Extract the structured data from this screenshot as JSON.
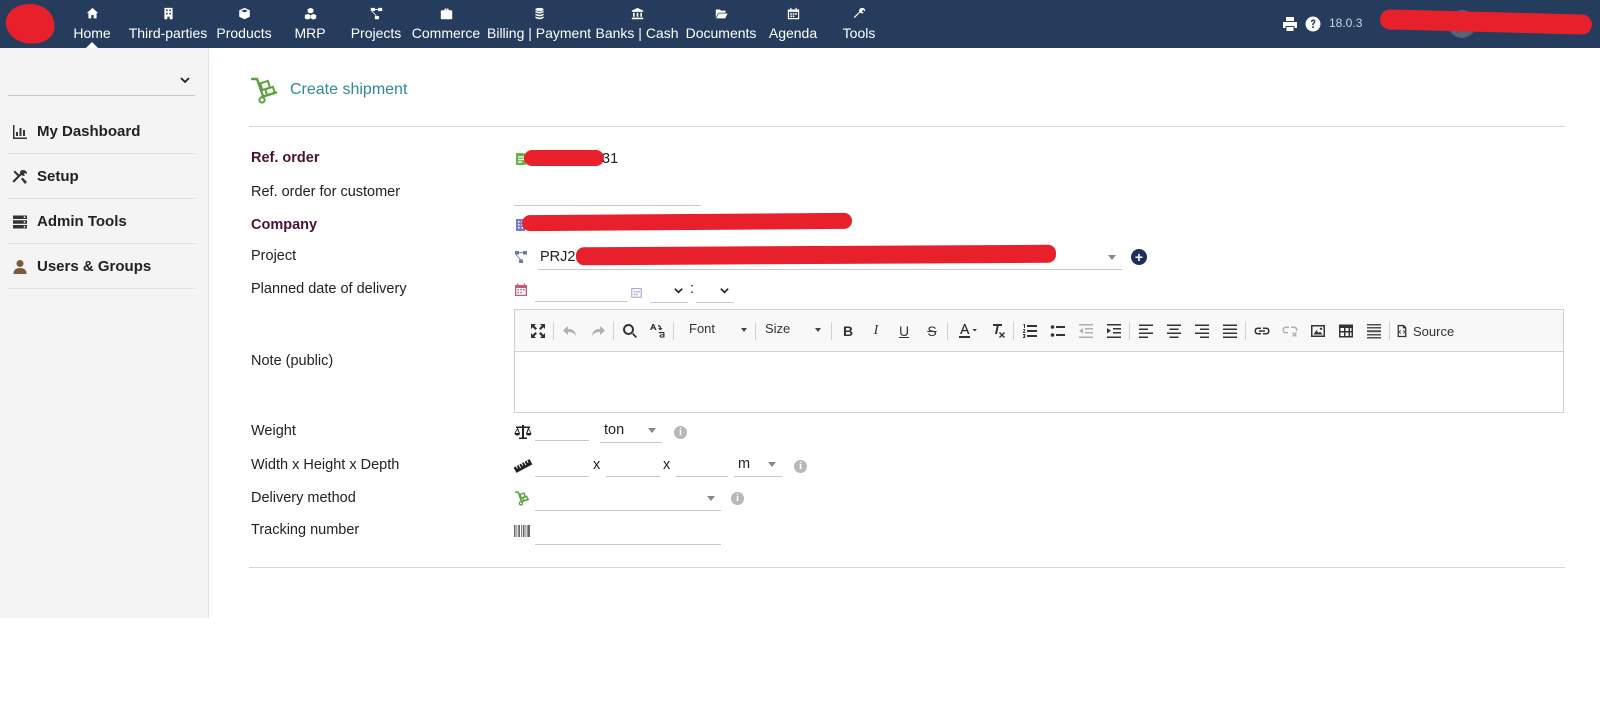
{
  "topnav": {
    "items": [
      {
        "label": "Home",
        "icon": "home-icon"
      },
      {
        "label": "Third-parties",
        "icon": "building-icon"
      },
      {
        "label": "Products",
        "icon": "cube-icon"
      },
      {
        "label": "MRP",
        "icon": "cubes-icon"
      },
      {
        "label": "Projects",
        "icon": "project-diagram-icon"
      },
      {
        "label": "Commerce",
        "icon": "suitcase-icon"
      },
      {
        "label": "Billing | Payment",
        "icon": "coins-icon"
      },
      {
        "label": "Banks | Cash",
        "icon": "bank-icon"
      },
      {
        "label": "Documents",
        "icon": "folder-open-icon"
      },
      {
        "label": "Agenda",
        "icon": "calendar-icon"
      },
      {
        "label": "Tools",
        "icon": "wrench-icon"
      }
    ],
    "version": "18.0.3"
  },
  "sidebar": {
    "items": [
      {
        "label": "My Dashboard",
        "icon": "chart-bar-icon"
      },
      {
        "label": "Setup",
        "icon": "tools-icon"
      },
      {
        "label": "Admin Tools",
        "icon": "server-icon"
      },
      {
        "label": "Users & Groups",
        "icon": "user-icon"
      }
    ]
  },
  "page": {
    "title": "Create shipment"
  },
  "form": {
    "ref_order_label": "Ref. order",
    "ref_order_value_suffix": "31",
    "ref_customer_label": "Ref. order for customer",
    "company_label": "Company",
    "project_label": "Project",
    "project_value_prefix": "PRJ2",
    "planned_date_label": "Planned date of delivery",
    "time_separator": ":",
    "note_label": "Note (public)",
    "weight_label": "Weight",
    "weight_unit": "ton",
    "dimensions_label": "Width x Height x Depth",
    "dim_sep1": "x",
    "dim_sep2": "x",
    "dim_unit": "m",
    "delivery_method_label": "Delivery method",
    "tracking_label": "Tracking number",
    "info_glyph": "i",
    "add_glyph": "+"
  },
  "editor": {
    "font_label": "Font",
    "size_label": "Size",
    "source_label": "Source"
  },
  "colors": {
    "topbar": "#263c5c",
    "accent_title": "#2d8a9c",
    "required_label": "#4a1036",
    "redaction": "#e8202c"
  }
}
